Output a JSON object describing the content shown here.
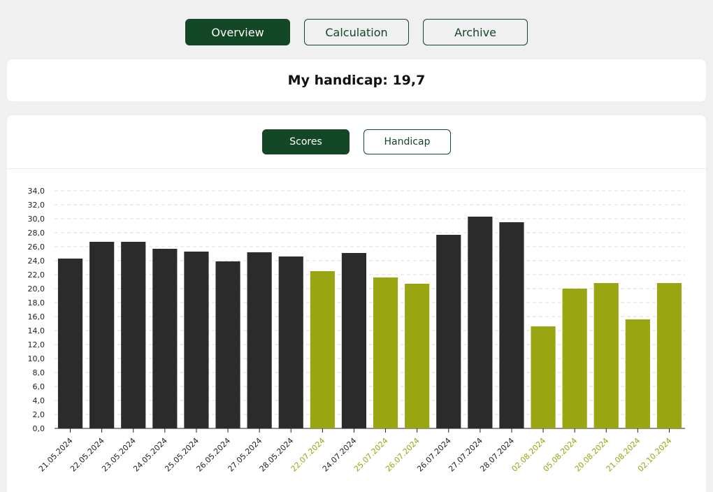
{
  "nav": {
    "tabs": [
      {
        "label": "Overview",
        "active": true
      },
      {
        "label": "Calculation",
        "active": false
      },
      {
        "label": "Archive",
        "active": false
      }
    ]
  },
  "handicap": {
    "label": "My handicap: 19,7"
  },
  "chart_tabs": [
    {
      "label": "Scores",
      "active": true
    },
    {
      "label": "Handicap",
      "active": false
    }
  ],
  "colors": {
    "accent": "#144726",
    "bar_dark": "#2b2b2b",
    "bar_highlight": "#9aa512"
  },
  "chart_data": {
    "type": "bar",
    "ylim": [
      0,
      34
    ],
    "ytick_step": 2,
    "ytick_labels": [
      "0,0",
      "2,0",
      "4,0",
      "6,0",
      "8,0",
      "10,0",
      "12,0",
      "14,0",
      "16,0",
      "18,0",
      "20,0",
      "22,0",
      "24,0",
      "26,0",
      "28,0",
      "30,0",
      "32,0",
      "34,0"
    ],
    "grid": true,
    "categories": [
      "21.05.2024",
      "22.05.2024",
      "23.05.2024",
      "24.05.2024",
      "25.05.2024",
      "26.05.2024",
      "27.05.2024",
      "28.05.2024",
      "22.07.2024",
      "24.07.2024",
      "25.07.2024",
      "26.07.2024",
      "26.07.2024",
      "27.07.2024",
      "28.07.2024",
      "02.08.2024",
      "05.08.2024",
      "20.08.2024",
      "21.08.2024",
      "02.10.2024"
    ],
    "values": [
      24.3,
      26.7,
      26.7,
      25.7,
      25.3,
      23.9,
      25.2,
      24.6,
      22.5,
      25.1,
      21.6,
      20.7,
      27.7,
      30.3,
      29.5,
      14.6,
      20.0,
      20.8,
      15.6,
      20.8
    ],
    "highlighted": [
      false,
      false,
      false,
      false,
      false,
      false,
      false,
      false,
      true,
      false,
      true,
      true,
      false,
      false,
      false,
      true,
      true,
      true,
      true,
      true
    ]
  }
}
